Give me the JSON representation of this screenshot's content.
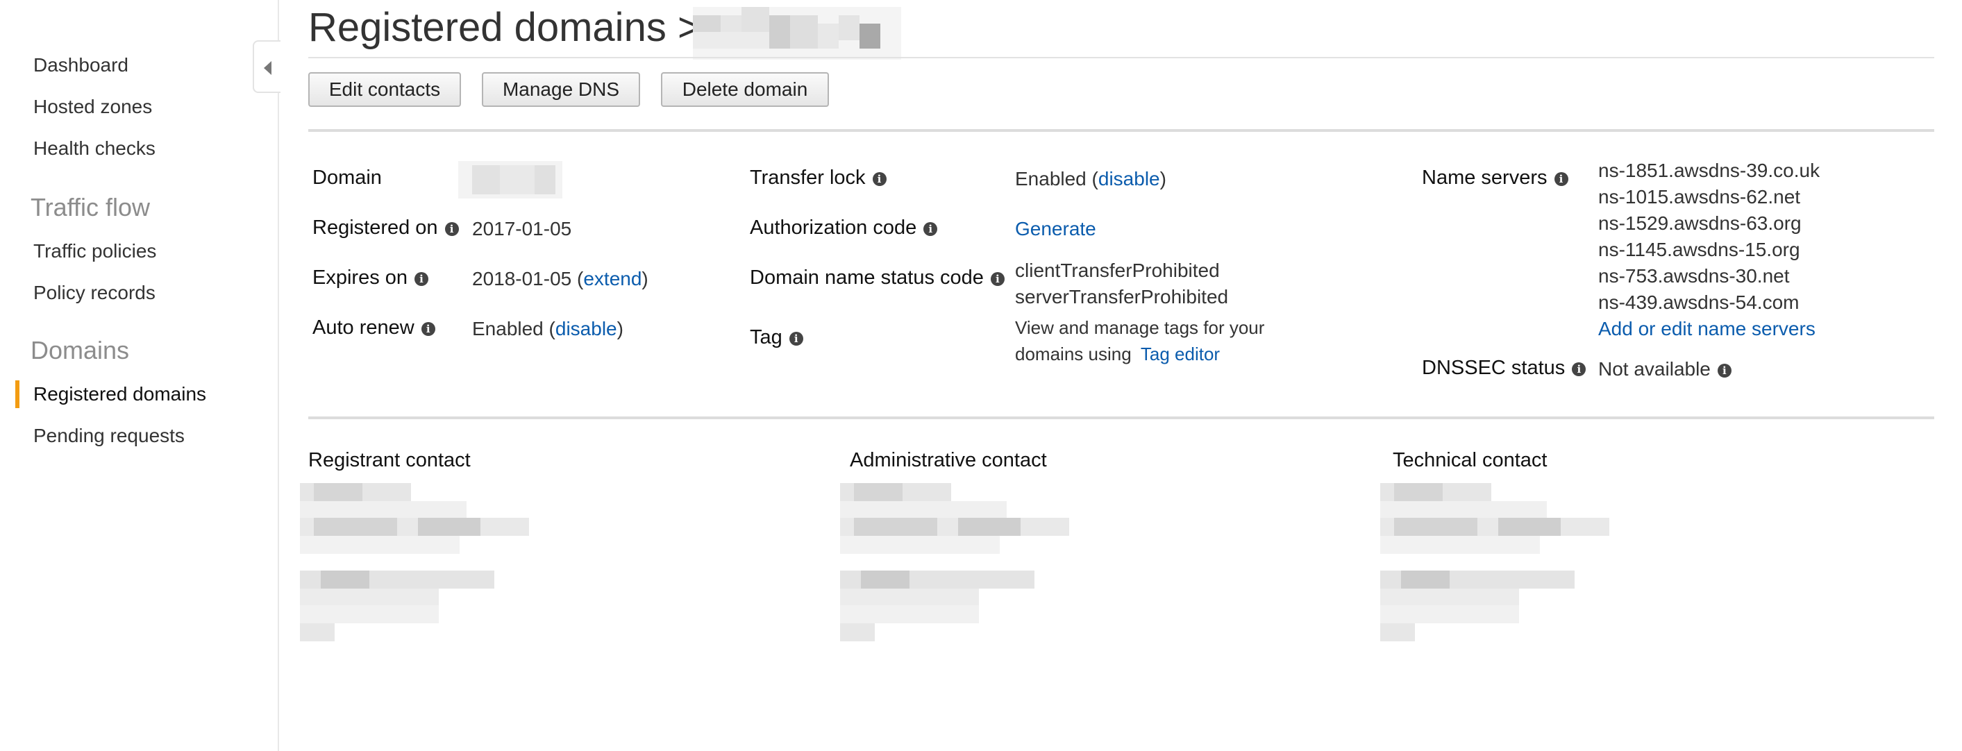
{
  "sidebar": {
    "items_top": [
      "Dashboard",
      "Hosted zones",
      "Health checks"
    ],
    "traffic_flow_heading": "Traffic flow",
    "traffic_flow_items": [
      "Traffic policies",
      "Policy records"
    ],
    "domains_heading": "Domains",
    "domains_items": [
      "Registered domains",
      "Pending requests"
    ],
    "active_item": "Registered domains",
    "accent_color": "#f39c12"
  },
  "header": {
    "title": "Registered domains >"
  },
  "toolbar": {
    "edit_contacts": "Edit contacts",
    "manage_dns": "Manage DNS",
    "delete_domain": "Delete domain"
  },
  "details": {
    "domain_label": "Domain",
    "registered_on_label": "Registered on",
    "registered_on_value": "2017-01-05",
    "expires_on_label": "Expires on",
    "expires_on_value": "2018-01-05 (",
    "expires_on_link": "extend",
    "expires_on_close": ")",
    "auto_renew_label": "Auto renew",
    "auto_renew_value": "Enabled (",
    "auto_renew_link": "disable",
    "auto_renew_close": ")",
    "transfer_lock_label": "Transfer lock",
    "transfer_lock_value": "Enabled (",
    "transfer_lock_link": "disable",
    "transfer_lock_close": ")",
    "authorization_code_label": "Authorization code",
    "authorization_code_link": "Generate",
    "status_code_label": "Domain name status code",
    "status_codes": [
      "clientTransferProhibited",
      "serverTransferProhibited"
    ],
    "tag_label": "Tag",
    "tag_text_line1": "View and manage tags for your",
    "tag_text_line2": "domains using",
    "tag_link": "Tag editor",
    "name_servers_label": "Name servers",
    "name_servers": [
      "ns-1851.awsdns-39.co.uk",
      "ns-1015.awsdns-62.net",
      "ns-1529.awsdns-63.org",
      "ns-1145.awsdns-15.org",
      "ns-753.awsdns-30.net",
      "ns-439.awsdns-54.com"
    ],
    "name_servers_link": "Add or edit name servers",
    "dnssec_label": "DNSSEC status",
    "dnssec_value": "Not available"
  },
  "contacts": {
    "registrant": "Registrant contact",
    "administrative": "Administrative contact",
    "technical": "Technical contact"
  },
  "icons": {
    "info": "info-icon",
    "collapse": "chevron-left-icon"
  }
}
